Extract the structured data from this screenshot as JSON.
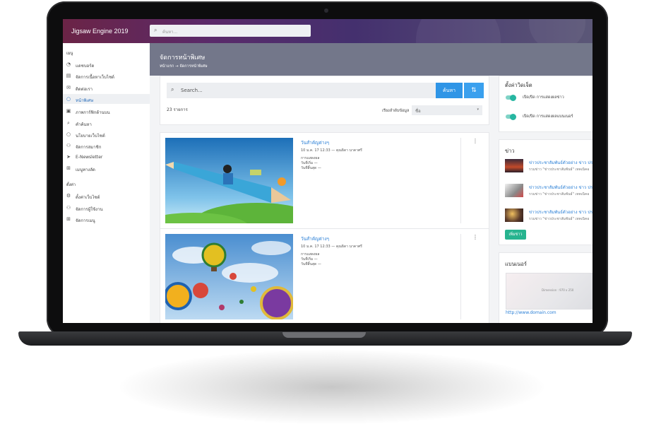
{
  "app": {
    "title": "Jigsaw Engine 2019"
  },
  "topbar": {
    "search_placeholder": "ค้นหา..."
  },
  "sidebar": {
    "section_menu": "เมนู",
    "menu_items": [
      {
        "label": "แดชบอร์ด",
        "icon": "dashboard-icon"
      },
      {
        "label": "จัดการเนื้อหาเว็บไซต์",
        "icon": "layers-icon"
      },
      {
        "label": "ติดต่อเรา",
        "icon": "mail-icon"
      },
      {
        "label": "หน้าพิเศษ",
        "icon": "circle-icon",
        "active": true
      },
      {
        "label": "ภาพการ์ฟิกด้านบน",
        "icon": "image-icon"
      },
      {
        "label": "คำค้นหา",
        "icon": "search-icon"
      },
      {
        "label": "นโยบายเว็บไซต์",
        "icon": "circle-icon"
      },
      {
        "label": "จัดการสมาชิก",
        "icon": "users-icon"
      },
      {
        "label": "E-Newsletter",
        "icon": "send-icon"
      },
      {
        "label": "เมนูทางลัด",
        "icon": "sitemap-icon"
      }
    ],
    "section_settings": "ตั้งค่า",
    "settings_items": [
      {
        "label": "ตั้งค่าเว็บไซต์",
        "icon": "gear-icon"
      },
      {
        "label": "จัดการผู้ใช้งาน",
        "icon": "users-icon"
      },
      {
        "label": "จัดการเมนู",
        "icon": "sitemap-icon"
      }
    ]
  },
  "header": {
    "title": "จัดการหน้าพิเศษ",
    "breadcrumb": "หน้าแรก → จัดการหน้าพิเศษ"
  },
  "search": {
    "placeholder": "Search...",
    "button": "ค้นหา",
    "count": "23 รายการ",
    "sort_label": "เรียงลำดับข้อมูล",
    "sort_value": "ชื่อ"
  },
  "items": [
    {
      "title": "วันสำคัญต่างๆ",
      "meta": "10 ม.ค. 17 12:33 — คุณธิดา นาคาศรี",
      "status": "การแสดงผล",
      "start": "วันที่เริ่ม —",
      "end": "วันที่สิ้นสุด —"
    },
    {
      "title": "วันสำคัญต่างๆ",
      "meta": "10 ม.ค. 17 12:33 — คุณธิดา นาคาศรี",
      "status": "การแสดงผล",
      "start": "วันที่เริ่ม —",
      "end": "วันที่สิ้นสุด —"
    }
  ],
  "widgets": {
    "title": "ตั้งค่าวิดเจ็ต",
    "toggles": [
      {
        "label": "เปิด/ปิด การแสดงผลข่าว",
        "on": true
      },
      {
        "label": "เปิด/ปิด การแสดงผลแบนเนอร์",
        "on": true
      }
    ]
  },
  "news": {
    "title": "ข่าว",
    "items": [
      {
        "title": "ข่าวประชาสัมพันธ์ตัวอย่าง ข่าว ปร",
        "sub": "รวมข่าว \"ข่าวประชาสัมพันธ์\" เทคเนิคอ"
      },
      {
        "title": "ข่าวประชาสัมพันธ์ตัวอย่าง ข่าว ปร",
        "sub": "รวมข่าว \"ข่าวประชาสัมพันธ์\" เทคเนิคอ"
      },
      {
        "title": "ข่าวประชาสัมพันธ์ตัวอย่าง ข่าว ปร",
        "sub": "รวมข่าว \"ข่าวประชาสัมพันธ์\" เทคเนิคอ"
      }
    ],
    "more_button": "เพิ่มข่าว"
  },
  "banner": {
    "title": "แบนเนอร์",
    "size_text": "Dimension : 970 x 250",
    "link": "http://www.domain.com"
  },
  "colors": {
    "accent": "#2f95e6",
    "toggle": "#26b6a1",
    "more_button": "#27b48f",
    "link": "#2a7fd6"
  }
}
